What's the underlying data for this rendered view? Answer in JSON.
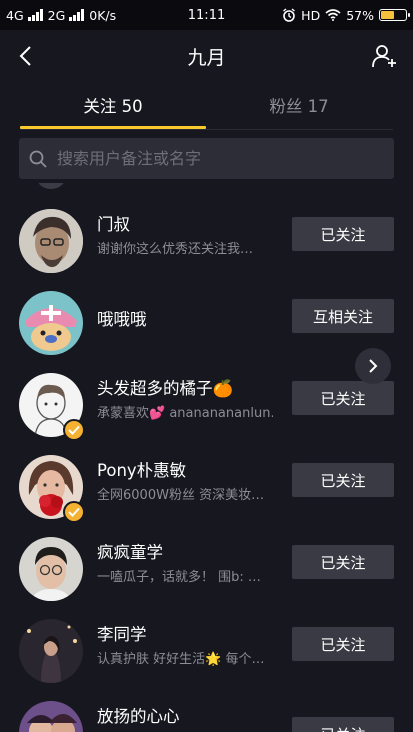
{
  "status_bar": {
    "network1": "4G",
    "network2": "2G",
    "speed": "0K/s",
    "time": "11:11",
    "hd": "HD",
    "battery_text": "57%",
    "battery_level": 0.57
  },
  "header": {
    "title": "九月"
  },
  "tabs": [
    {
      "label": "关注 50",
      "active": true
    },
    {
      "label": "粉丝 17",
      "active": false
    }
  ],
  "search": {
    "placeholder": "搜索用户备注或名字"
  },
  "users": [
    {
      "name": "门叔",
      "desc": "谢谢你这么优秀还关注我…",
      "button": "已关注",
      "verified": false
    },
    {
      "name": "哦哦哦",
      "desc": "",
      "button": "互相关注",
      "verified": false
    },
    {
      "name": "头发超多的橘子🍊",
      "desc": "承蒙喜欢💕 anananananlun…",
      "button": "已关注",
      "verified": true
    },
    {
      "name": "Pony朴惠敏",
      "desc": "全网6000W粉丝 资深美妆…",
      "button": "已关注",
      "verified": true
    },
    {
      "name": "疯疯童学",
      "desc": "一嗑瓜子，话就多！ 围b: …",
      "button": "已关注",
      "verified": false
    },
    {
      "name": "李同学",
      "desc": "认真护肤 好好生活🌟 每个…",
      "button": "已关注",
      "verified": false
    },
    {
      "name": "放扬的心心",
      "desc": "",
      "button": "已关注",
      "verified": false
    }
  ],
  "colors": {
    "accent": "#f8c92c",
    "background": "#16171f",
    "button": "#393a43"
  }
}
